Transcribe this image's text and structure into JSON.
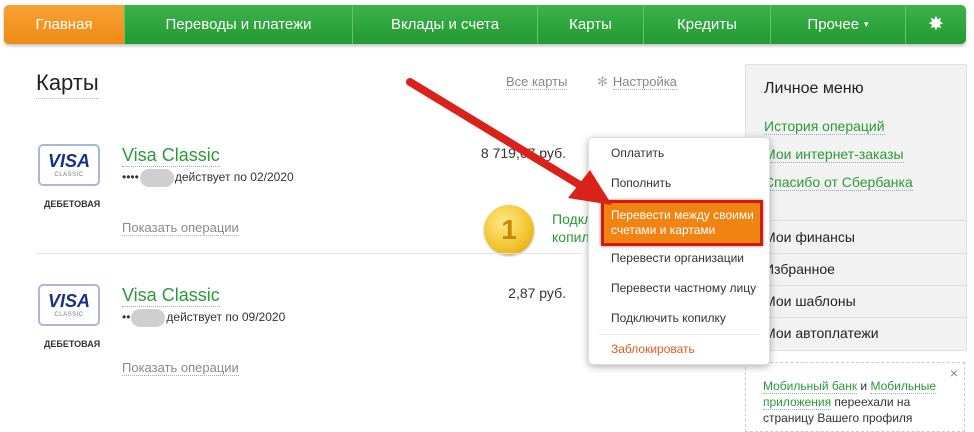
{
  "nav": [
    {
      "label": "Главная"
    },
    {
      "label": "Переводы и платежи"
    },
    {
      "label": "Вклады и счета"
    },
    {
      "label": "Карты"
    },
    {
      "label": "Кредиты"
    },
    {
      "label": "Прочее"
    }
  ],
  "main": {
    "title": "Карты",
    "all_cards": "Все карты",
    "settings": "Настройка"
  },
  "cards": [
    {
      "logo": "VISA",
      "logo_sub": "CLASSIC",
      "type": "ДЕБЕТОВАЯ",
      "name": "Visa Classic",
      "number_prefix": "••••",
      "valid": "действует по 02/2020",
      "amount": "8 719,67 руб.",
      "ops": "Показать операции"
    },
    {
      "logo": "VISA",
      "logo_sub": "CLASSIC",
      "type": "ДЕБЕТОВАЯ",
      "name": "Visa Classic",
      "number_prefix": "••",
      "valid": "действует по 09/2020",
      "amount": "2,87 руб.",
      "ops": "Показать операции"
    }
  ],
  "promo": {
    "coin": "1",
    "line1": "Подкл",
    "line2": "копил"
  },
  "dropdown": {
    "items": [
      "Оплатить",
      "Пополнить",
      "Перевести между своими счетами и картами",
      "Перевести организации",
      "Перевести частному лицу",
      "Подключить копилку",
      "Заблокировать"
    ]
  },
  "panel": {
    "title": "Личное меню",
    "links": [
      "История операций",
      "Мои интернет-заказы",
      "Спасибо от Сбербанка"
    ],
    "items": [
      "Мои финансы",
      "Избранное",
      "Мои шаблоны",
      "Мои автоплатежи"
    ]
  },
  "note": {
    "link1": "Мобильный банк",
    "and": " и ",
    "link2": "Мобильные приложения",
    "text": " переехали на страницу Вашего профиля",
    "close": "×"
  },
  "colors": {
    "brand_green": "#2a9a38",
    "active_orange": "#ef8a15",
    "highlight_red": "#d41a10"
  }
}
